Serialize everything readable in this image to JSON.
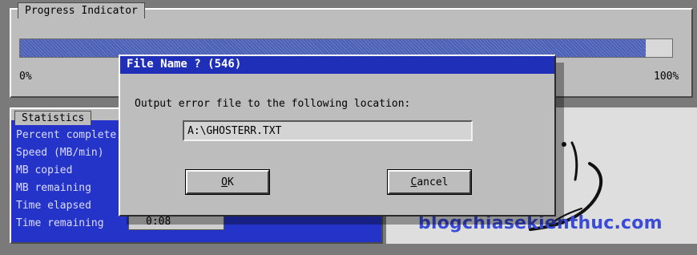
{
  "progress": {
    "title": "Progress Indicator",
    "fraction": 0.96,
    "min_label": "0%",
    "max_label": "100%"
  },
  "statistics": {
    "title": "Statistics",
    "labels": [
      "Percent complete",
      "Speed (MB/min)",
      "MB copied",
      "MB remaining",
      "Time elapsed",
      "Time remaining"
    ],
    "time_remaining_value": "0:08"
  },
  "dialog": {
    "title": "File Name ? (546)",
    "message": "Output error file to the following location:",
    "path_value": "A:\\GHOSTERR.TXT",
    "ok_hotkey": "O",
    "ok_rest": "K",
    "cancel_hotkey": "C",
    "cancel_rest": "ancel"
  },
  "watermark": "blogchiasekienthuc.com",
  "colors": {
    "panel": "#bdbdbd",
    "title_bar": "#1f2fb8",
    "progress_fill": "#4a5fb5",
    "stats_blue": "#2434c9"
  }
}
